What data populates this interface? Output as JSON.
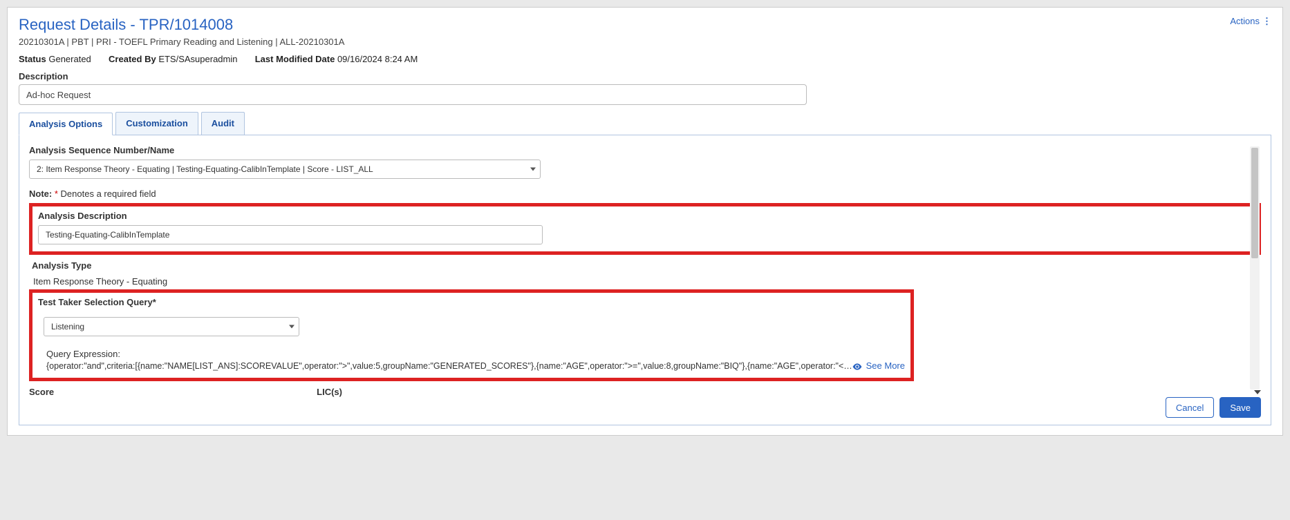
{
  "header": {
    "title": "Request Details - TPR/1014008",
    "subtitle": "20210301A | PBT | PRI - TOEFL Primary Reading and Listening | ALL-20210301A",
    "status_label": "Status",
    "status_value": "Generated",
    "created_by_label": "Created By",
    "created_by_value": "ETS/SAsuperadmin",
    "last_modified_label": "Last Modified Date",
    "last_modified_value": "09/16/2024 8:24 AM",
    "actions_label": "Actions"
  },
  "description": {
    "label": "Description",
    "value": "Ad-hoc Request"
  },
  "tabs": {
    "analysis": "Analysis Options",
    "customization": "Customization",
    "audit": "Audit"
  },
  "analysis": {
    "seq_label": "Analysis Sequence Number/Name",
    "seq_value": "2: Item Response Theory - Equating | Testing-Equating-CalibInTemplate | Score - LIST_ALL",
    "note_prefix": "Note:",
    "note_text": "Denotes a required field",
    "desc_label": "Analysis Description",
    "desc_value": "Testing-Equating-CalibInTemplate",
    "type_label": "Analysis Type",
    "type_value": "Item Response Theory - Equating",
    "ttq_label": "Test Taker Selection Query",
    "ttq_value": "Listening",
    "qexpr_label": "Query Expression:",
    "qexpr_text": "{operator:\"and\",criteria:[{name:\"NAME[LIST_ANS]:SCOREVALUE\",operator:\">\",value:5,groupName:\"GENERATED_SCORES\"},{name:\"AGE\",operator:\">=\",value:8,groupName:\"BIQ\"},{name:\"AGE\",operator:\"<=\",va...",
    "see_more": "See More",
    "score_label": "Score",
    "lic_label": "LIC(s)"
  },
  "buttons": {
    "cancel": "Cancel",
    "save": "Save"
  }
}
